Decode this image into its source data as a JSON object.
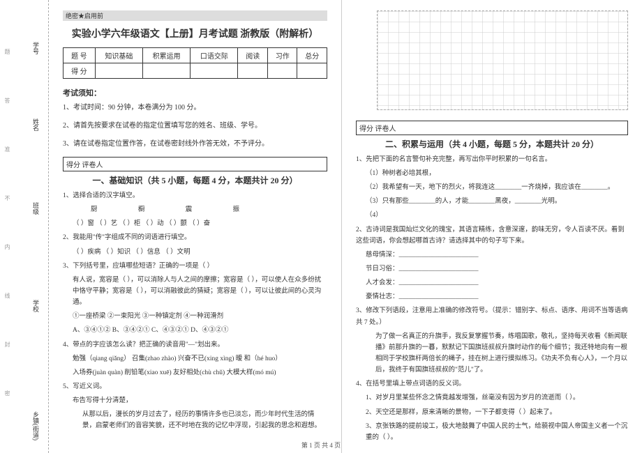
{
  "secret_label": "绝密★启用前",
  "title": "实验小学六年级语文【上册】月考试题 浙教版（附解析）",
  "score_table": {
    "headers": [
      "题 号",
      "知识基础",
      "积累运用",
      "口语交际",
      "阅读",
      "习作",
      "总分"
    ],
    "row_label": "得 分"
  },
  "notice_title": "考试须知：",
  "notices": [
    "1、考试时间：90 分钟，本卷满分为 100 分。",
    "2、请首先按要求在试卷的指定位置填写您的姓名、班级、学号。",
    "3、请在试卷指定位置作答，在试卷密封线外作答无效，不予评分。"
  ],
  "scorebox": "得分  评卷人",
  "section1_title": "一、基础知识（共 5 小题，每题 4 分，本题共计 20 分）",
  "q1": {
    "stem": "1、选择合适的汉字填空。",
    "chars_line1": "厨  橱  震  振",
    "line2": "（  ）窗    （  ）艺    （  ）柜    （  ）动    （  ）颤    （  ）奋"
  },
  "q2": {
    "stem": "2、我能用\"传\"字组成不同的词语进行填空。",
    "line": "（      ）疾病    （      ）知识    （      ）信息    （      ）文明"
  },
  "q3": {
    "stem": "3、下列括号里，应填哪些短语？正确的一项是（  ）",
    "body": "有人说，宽容是（  ），可以消除人与人之间的摩擦；宽容是（  ），可以使人在众多纷扰中恪守平静；宽容是（  ），可以消融彼此的猜疑；宽容是（  ），可以让彼此间的心灵沟通。",
    "opts_line": "①一座桥梁    ②一束阳光    ③一种镇定剂    ④一种润滑剂",
    "choices": "A、③④①②    B、③④②①    C、④③②①    D、④③②①"
  },
  "q4": {
    "stem": "4、带点的字应该怎么读？把正确的读音用\"—\"划出来。",
    "l1": "勉强（qiang qiǎng）   召集(zhao zhào)   兴奋不已(xing xìng)   暧 和（hé huo）",
    "l2": "入场券(juàn quàn)    削铅笔(xiao xuē)   友好相处(chù chǔ)    大模大样(mó mú)"
  },
  "q5": {
    "stem": "5、写近义词。",
    "body": "布告写得十分清楚，",
    "p1": "从那以后，漫长的岁月过去了，经历的事情许多也已淡忘，而少年时代生活的情景，启蒙老师们的音容笑貌，还不时地在我的记忆中浮现，引起我的思念和遐想。"
  },
  "section2_title": "二、积累与运用（共 4 小题，每题 5 分，本题共计 20 分）",
  "r1": {
    "stem": "1、先把下面的名言警句补充完整，再写出你平时积累的一句名言。",
    "a": "（1）种树者必培其根，",
    "b": "（2）我希望有一天，地下的烈火，将我连这________一齐烧掉，我应该在________。",
    "c": "（3）只有那些________的人，才能________黑夜，________光明。",
    "d": "（4）"
  },
  "r2": {
    "stem": "2、古诗词是我国灿烂文化的瑰宝，其语言精练，含意深邃，韵味无穷，令人百读不厌。看到这些词语，你会想起哪首古诗？请选择其中的句子写下来。",
    "items": [
      "慈母情深：________________________",
      "节日习俗：________________________",
      "人才会发：________________________",
      "豪情壮志：________________________"
    ]
  },
  "r3": {
    "stem": "3、修改下列语段，注意用上准确的修改符号。（提示：错别字、标点、语序、用词不当等语病共 7 处。）",
    "body": "为了做一名真正的升旗手，我反复掌握节奏，练唱国歌，敬礼，坚持每天收看《新闻联播》前那升旗的一暮，默默记下国旗班叔叔升旗时动作的每个细节；我还特地向有一根相同于学校旗杆两倍长的绳子，挂在树上进行摸拟练习。《功夫不负有心人》，一个月以后，我终于有国旗班叔叔的\"范儿\"了。"
  },
  "r4": {
    "stem": "4、在括号里填上带点词语的反义词。",
    "a": "1、对岁月里某些怀念之情竟越发增强，丝毫没有因为岁月的流逝而（      ）。",
    "b": "2、天空还是那样，原来清晰的景物，一下子都变得（      ）起来了。",
    "c": "3、京张铁路的提前竣工，极大地鼓舞了中国人民的士气，给藐视中国人帝国主义者一个沉重的（      ）。"
  },
  "binding": {
    "labels": [
      "乡镇(街道)",
      "学校",
      "班级",
      "姓名",
      "学号"
    ],
    "marks": [
      "密",
      "封",
      "线",
      "内",
      "不",
      "准",
      "答",
      "题"
    ]
  },
  "footer": "第 1 页 共 4 页"
}
